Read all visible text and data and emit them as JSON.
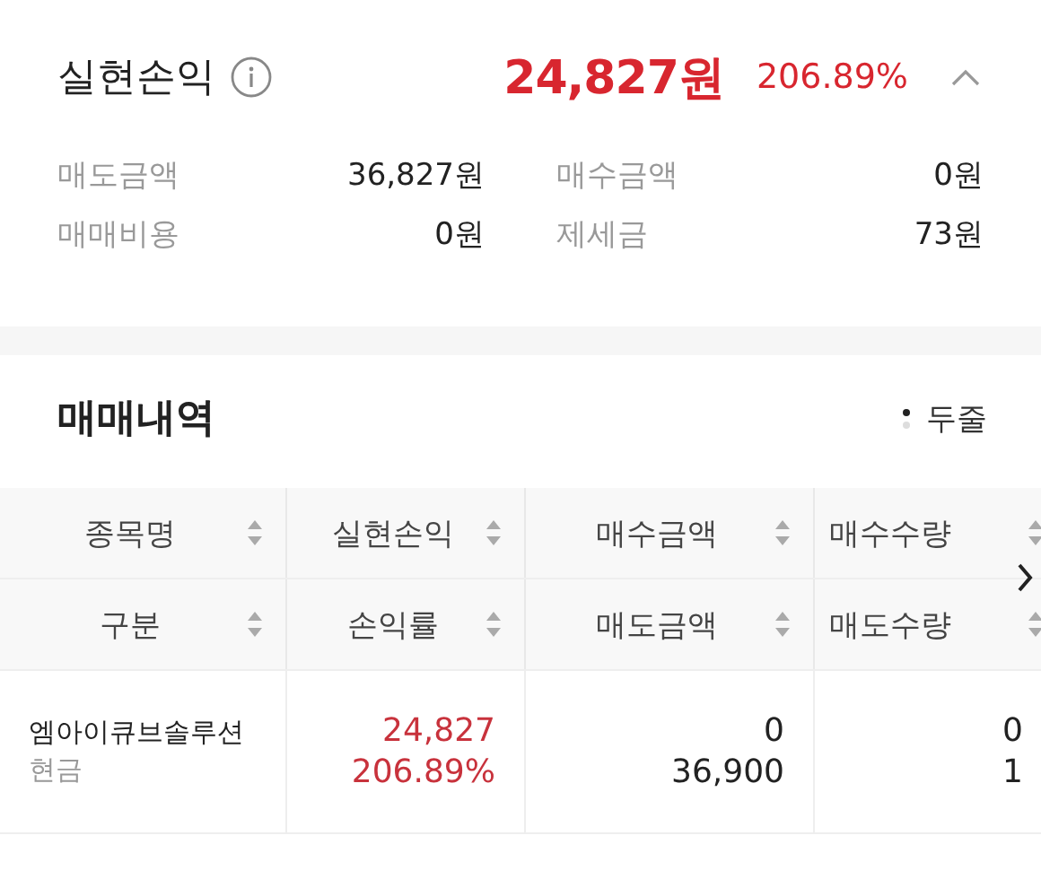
{
  "summary": {
    "title": "실현손익",
    "amount": "24,827원",
    "rate": "206.89%",
    "expanded": true,
    "items": [
      {
        "label": "매도금액",
        "value": "36,827원"
      },
      {
        "label": "매수금액",
        "value": "0원"
      },
      {
        "label": "매매비용",
        "value": "0원"
      },
      {
        "label": "제세금",
        "value": "73원"
      }
    ]
  },
  "trades": {
    "title": "매매내역",
    "view_toggle": "두줄",
    "header_rows": [
      [
        "종목명",
        "실현손익",
        "매수금액",
        "매수수량"
      ],
      [
        "구분",
        "손익률",
        "매도금액",
        "매도수량"
      ]
    ],
    "rows": [
      {
        "name": "엠아이큐브솔루션",
        "type": "현금",
        "profit": "24,827",
        "rate": "206.89%",
        "buy_amount": "0",
        "sell_amount": "36,900",
        "buy_qty": "0",
        "sell_qty": "1"
      }
    ]
  }
}
